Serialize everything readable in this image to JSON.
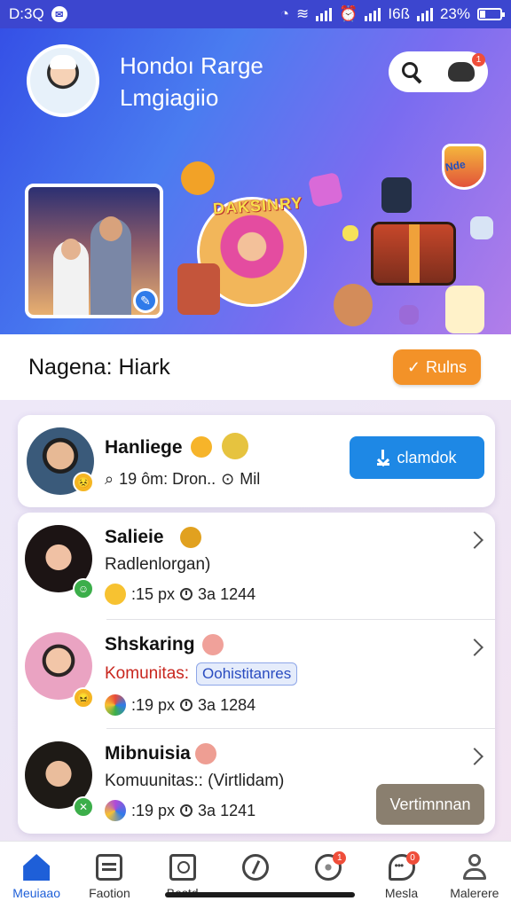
{
  "status_bar": {
    "time": "D:3Q",
    "battery": "23%",
    "carrier_text": "I6ß"
  },
  "header": {
    "title_line1": "Hondoı Rarge",
    "title_line2": "Lmgiagiio",
    "cart_badge": "1",
    "circle_label": "DAKSINRY",
    "trophy_label": "Nde"
  },
  "section": {
    "title": "Nagena: Hiark",
    "rules_label": "Rulns"
  },
  "featured": {
    "name": "Hanliege",
    "meta": "19 ôm: Dron..",
    "meta2": "Mil",
    "button_label": "clamdok"
  },
  "list": [
    {
      "name": "Salieie",
      "subtitle": "Radlenlorgan)",
      "stat": ":15 px",
      "time": "3a 1244"
    },
    {
      "name": "Shskaring",
      "subtitle": "Komunitas:",
      "tag": "Oohistitanres",
      "stat": ":19 px",
      "time": "3a 1284"
    },
    {
      "name": "Mibnuisia",
      "subtitle": "Komuunitas:: (Virtlidam)",
      "stat": ":19 px",
      "time": "3a 1241",
      "button_label": "Vertimnnan"
    }
  ],
  "nav": {
    "items": [
      {
        "label": "Meuiaao",
        "icon": "home-icon",
        "active": true
      },
      {
        "label": "Faotion",
        "icon": "box-icon"
      },
      {
        "label": "Bestd",
        "icon": "frame-icon"
      },
      {
        "label": "",
        "icon": "compass-icon"
      },
      {
        "label": "",
        "icon": "ball-icon",
        "badge": "1"
      },
      {
        "label": "Mesla",
        "icon": "chat-icon",
        "badge": "0"
      },
      {
        "label": "Malerere",
        "icon": "user-icon"
      }
    ]
  },
  "colors": {
    "primary": "#1e88e5",
    "accent": "#f39228",
    "hero_start": "#3550e6",
    "hero_end": "#b27ee9"
  }
}
